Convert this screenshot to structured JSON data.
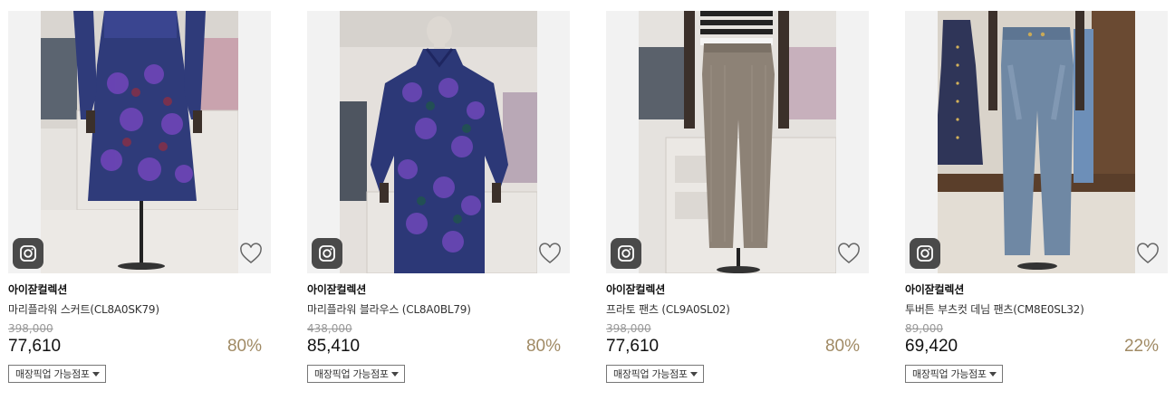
{
  "products": [
    {
      "brand": "아이잗컬렉션",
      "name": "마리플라워 스커트(CL8A0SK79)",
      "original_price": "398,000",
      "sale_price": "77,610",
      "discount": "80%",
      "pickup_label": "매장픽업 가능점포",
      "image_icon": "instagram-icon",
      "wish_icon": "heart-outline-icon"
    },
    {
      "brand": "아이잗컬렉션",
      "name": "마리플라워 블라우스 (CL8A0BL79)",
      "original_price": "438,000",
      "sale_price": "85,410",
      "discount": "80%",
      "pickup_label": "매장픽업 가능점포",
      "image_icon": "instagram-icon",
      "wish_icon": "heart-outline-icon"
    },
    {
      "brand": "아이잗컬렉션",
      "name": "프라토 팬츠 (CL9A0SL02)",
      "original_price": "398,000",
      "sale_price": "77,610",
      "discount": "80%",
      "pickup_label": "매장픽업 가능점포",
      "image_icon": "instagram-icon",
      "wish_icon": "heart-outline-icon"
    },
    {
      "brand": "아이잗컬렉션",
      "name": "투버튼 부츠컷 데님 팬츠(CM8E0SL32)",
      "original_price": "89,000",
      "sale_price": "69,420",
      "discount": "22%",
      "pickup_label": "매장픽업 가능점포",
      "image_icon": "instagram-icon",
      "wish_icon": "heart-outline-icon"
    }
  ],
  "colors": {
    "discount": "#a08a64",
    "strike_price": "#999999",
    "thumb_bg": "#f2f2f2",
    "insta_badge": "#4a4a4a"
  }
}
